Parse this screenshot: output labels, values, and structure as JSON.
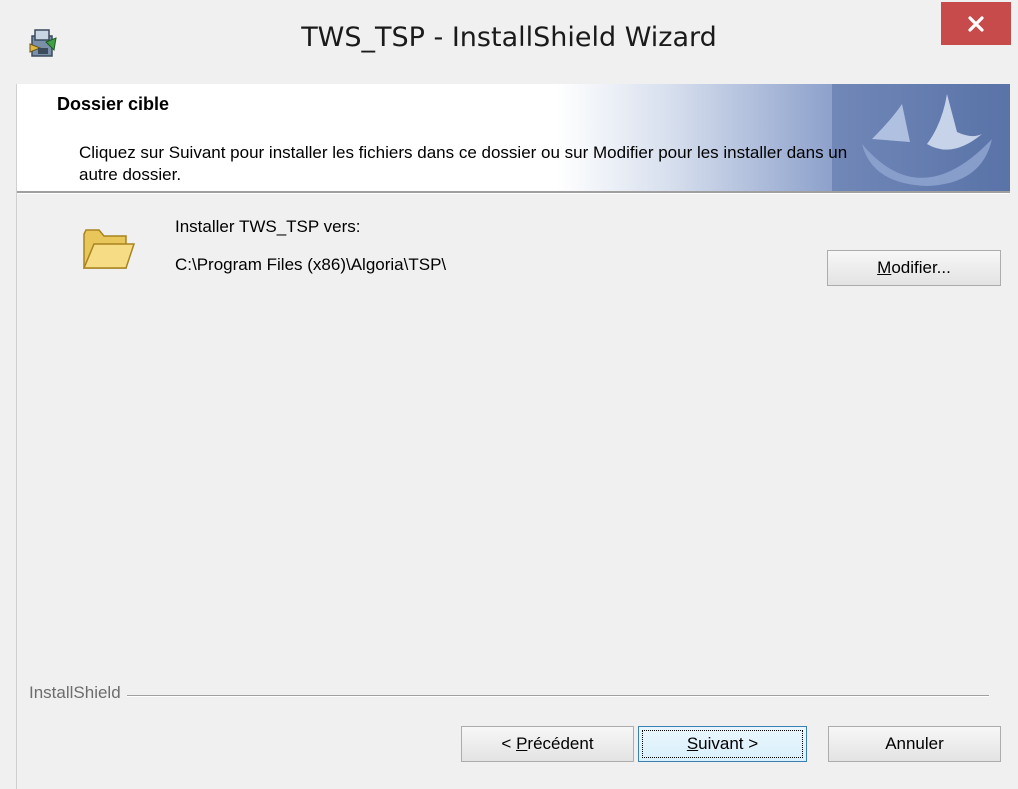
{
  "window": {
    "title": "TWS_TSP - InstallShield Wizard",
    "close_icon": "close-icon"
  },
  "banner": {
    "title": "Dossier cible",
    "description": "Cliquez sur Suivant pour installer les fichiers dans ce dossier ou sur Modifier pour les installer dans un autre dossier."
  },
  "destination": {
    "label": "Installer TWS_TSP vers:",
    "path": "C:\\Program Files (x86)\\Algoria\\TSP\\",
    "modify_button": {
      "prefix": "",
      "accel": "M",
      "suffix": "odifier..."
    }
  },
  "footer": {
    "brand": "InstallShield",
    "back_button": {
      "prefix": "< ",
      "accel": "P",
      "suffix": "récédent"
    },
    "next_button": {
      "prefix": "",
      "accel": "S",
      "suffix": "uivant >"
    },
    "cancel_button": "Annuler"
  },
  "colors": {
    "close_button": "#c74b4b",
    "dialog_background": "#f0f0f0",
    "banner_background": "#ffffff"
  }
}
